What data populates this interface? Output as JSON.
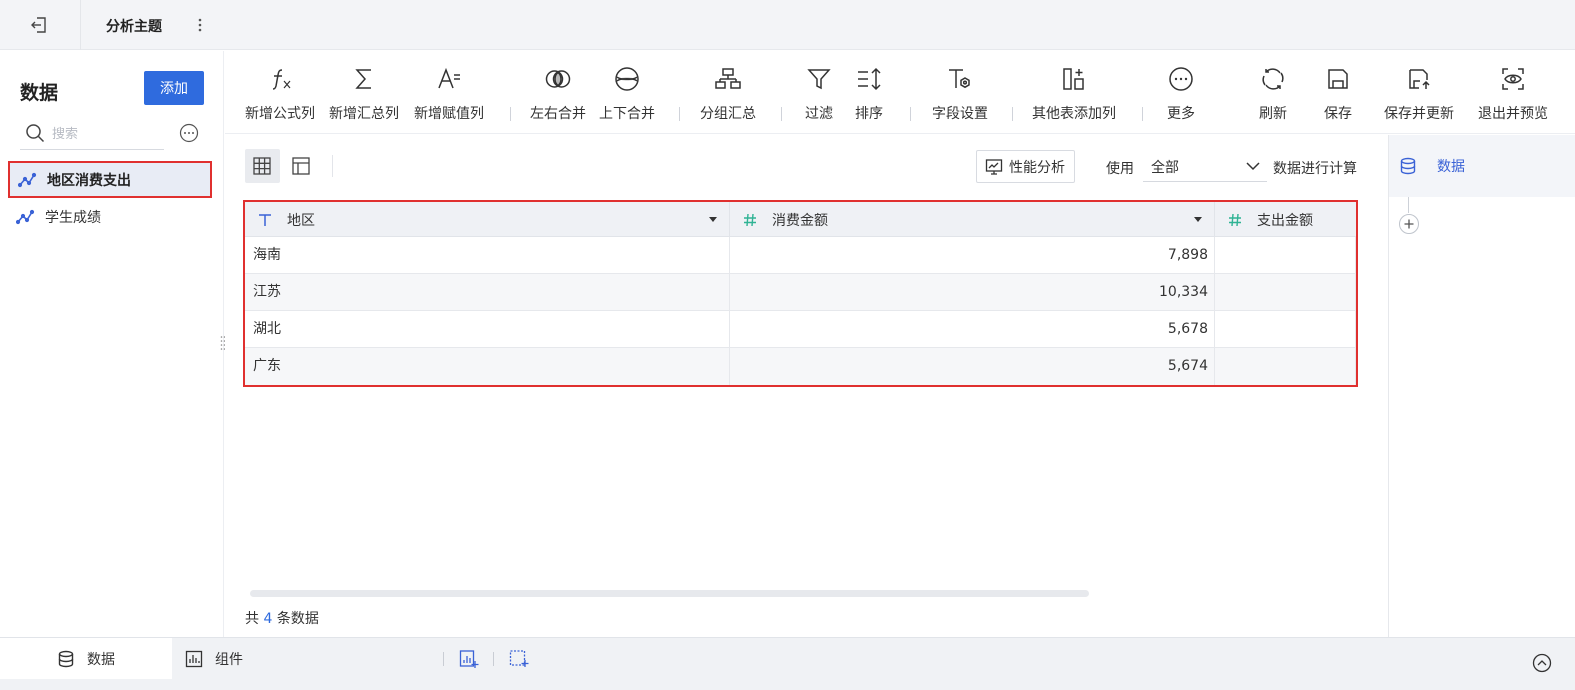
{
  "topbar": {
    "title": "分析主题",
    "back_icon": "exit-icon",
    "more_icon": "kebab-icon"
  },
  "left_panel": {
    "title": "数据",
    "add_label": "添加",
    "search": {
      "placeholder": "搜索",
      "value": ""
    },
    "datasets": [
      {
        "label": "地区消费支出",
        "icon": "dataset-icon",
        "active": true
      },
      {
        "label": "学生成绩",
        "icon": "dataset-icon",
        "active": false
      }
    ]
  },
  "toolbar": {
    "items": [
      {
        "label": "新增公式列",
        "icon": "formula-icon"
      },
      {
        "label": "新增汇总列",
        "icon": "sum-icon"
      },
      {
        "label": "新增赋值列",
        "icon": "assign-icon"
      },
      {
        "label": "左右合并",
        "icon": "merge-horizontal-icon"
      },
      {
        "label": "上下合并",
        "icon": "merge-vertical-icon"
      },
      {
        "label": "分组汇总",
        "icon": "group-icon"
      },
      {
        "label": "过滤",
        "icon": "filter-icon"
      },
      {
        "label": "排序",
        "icon": "sort-icon"
      },
      {
        "label": "字段设置",
        "icon": "field-settings-icon"
      },
      {
        "label": "其他表添加列",
        "icon": "add-column-icon"
      },
      {
        "label": "更多",
        "icon": "more-icon"
      },
      {
        "label": "刷新",
        "icon": "refresh-icon"
      },
      {
        "label": "保存",
        "icon": "save-icon"
      },
      {
        "label": "保存并更新",
        "icon": "save-update-icon"
      },
      {
        "label": "退出并预览",
        "icon": "preview-icon"
      }
    ]
  },
  "main": {
    "perf_label": "性能分析",
    "use_label": "使用",
    "use_value": "全部",
    "calc_label": "数据进行计算",
    "table": {
      "columns": [
        {
          "label": "地区",
          "type": "text"
        },
        {
          "label": "消费金额",
          "type": "number"
        },
        {
          "label": "支出金额",
          "type": "number"
        }
      ],
      "rows": [
        {
          "region": "海南",
          "amount": "7,898",
          "expense": ""
        },
        {
          "region": "江苏",
          "amount": "10,334",
          "expense": ""
        },
        {
          "region": "湖北",
          "amount": "5,678",
          "expense": ""
        },
        {
          "region": "广东",
          "amount": "5,674",
          "expense": ""
        }
      ]
    },
    "footer": {
      "prefix": "共",
      "count": "4",
      "suffix": "条数据"
    }
  },
  "right_panel": {
    "node_label": "数据"
  },
  "bottombar": {
    "tabs": [
      {
        "label": "数据",
        "icon": "database-icon",
        "active": true
      },
      {
        "label": "组件",
        "icon": "chart-icon",
        "active": false
      }
    ]
  },
  "colors": {
    "accent": "#2f6bde",
    "highlight_border": "#e0302f",
    "number_type": "#2fb394"
  }
}
